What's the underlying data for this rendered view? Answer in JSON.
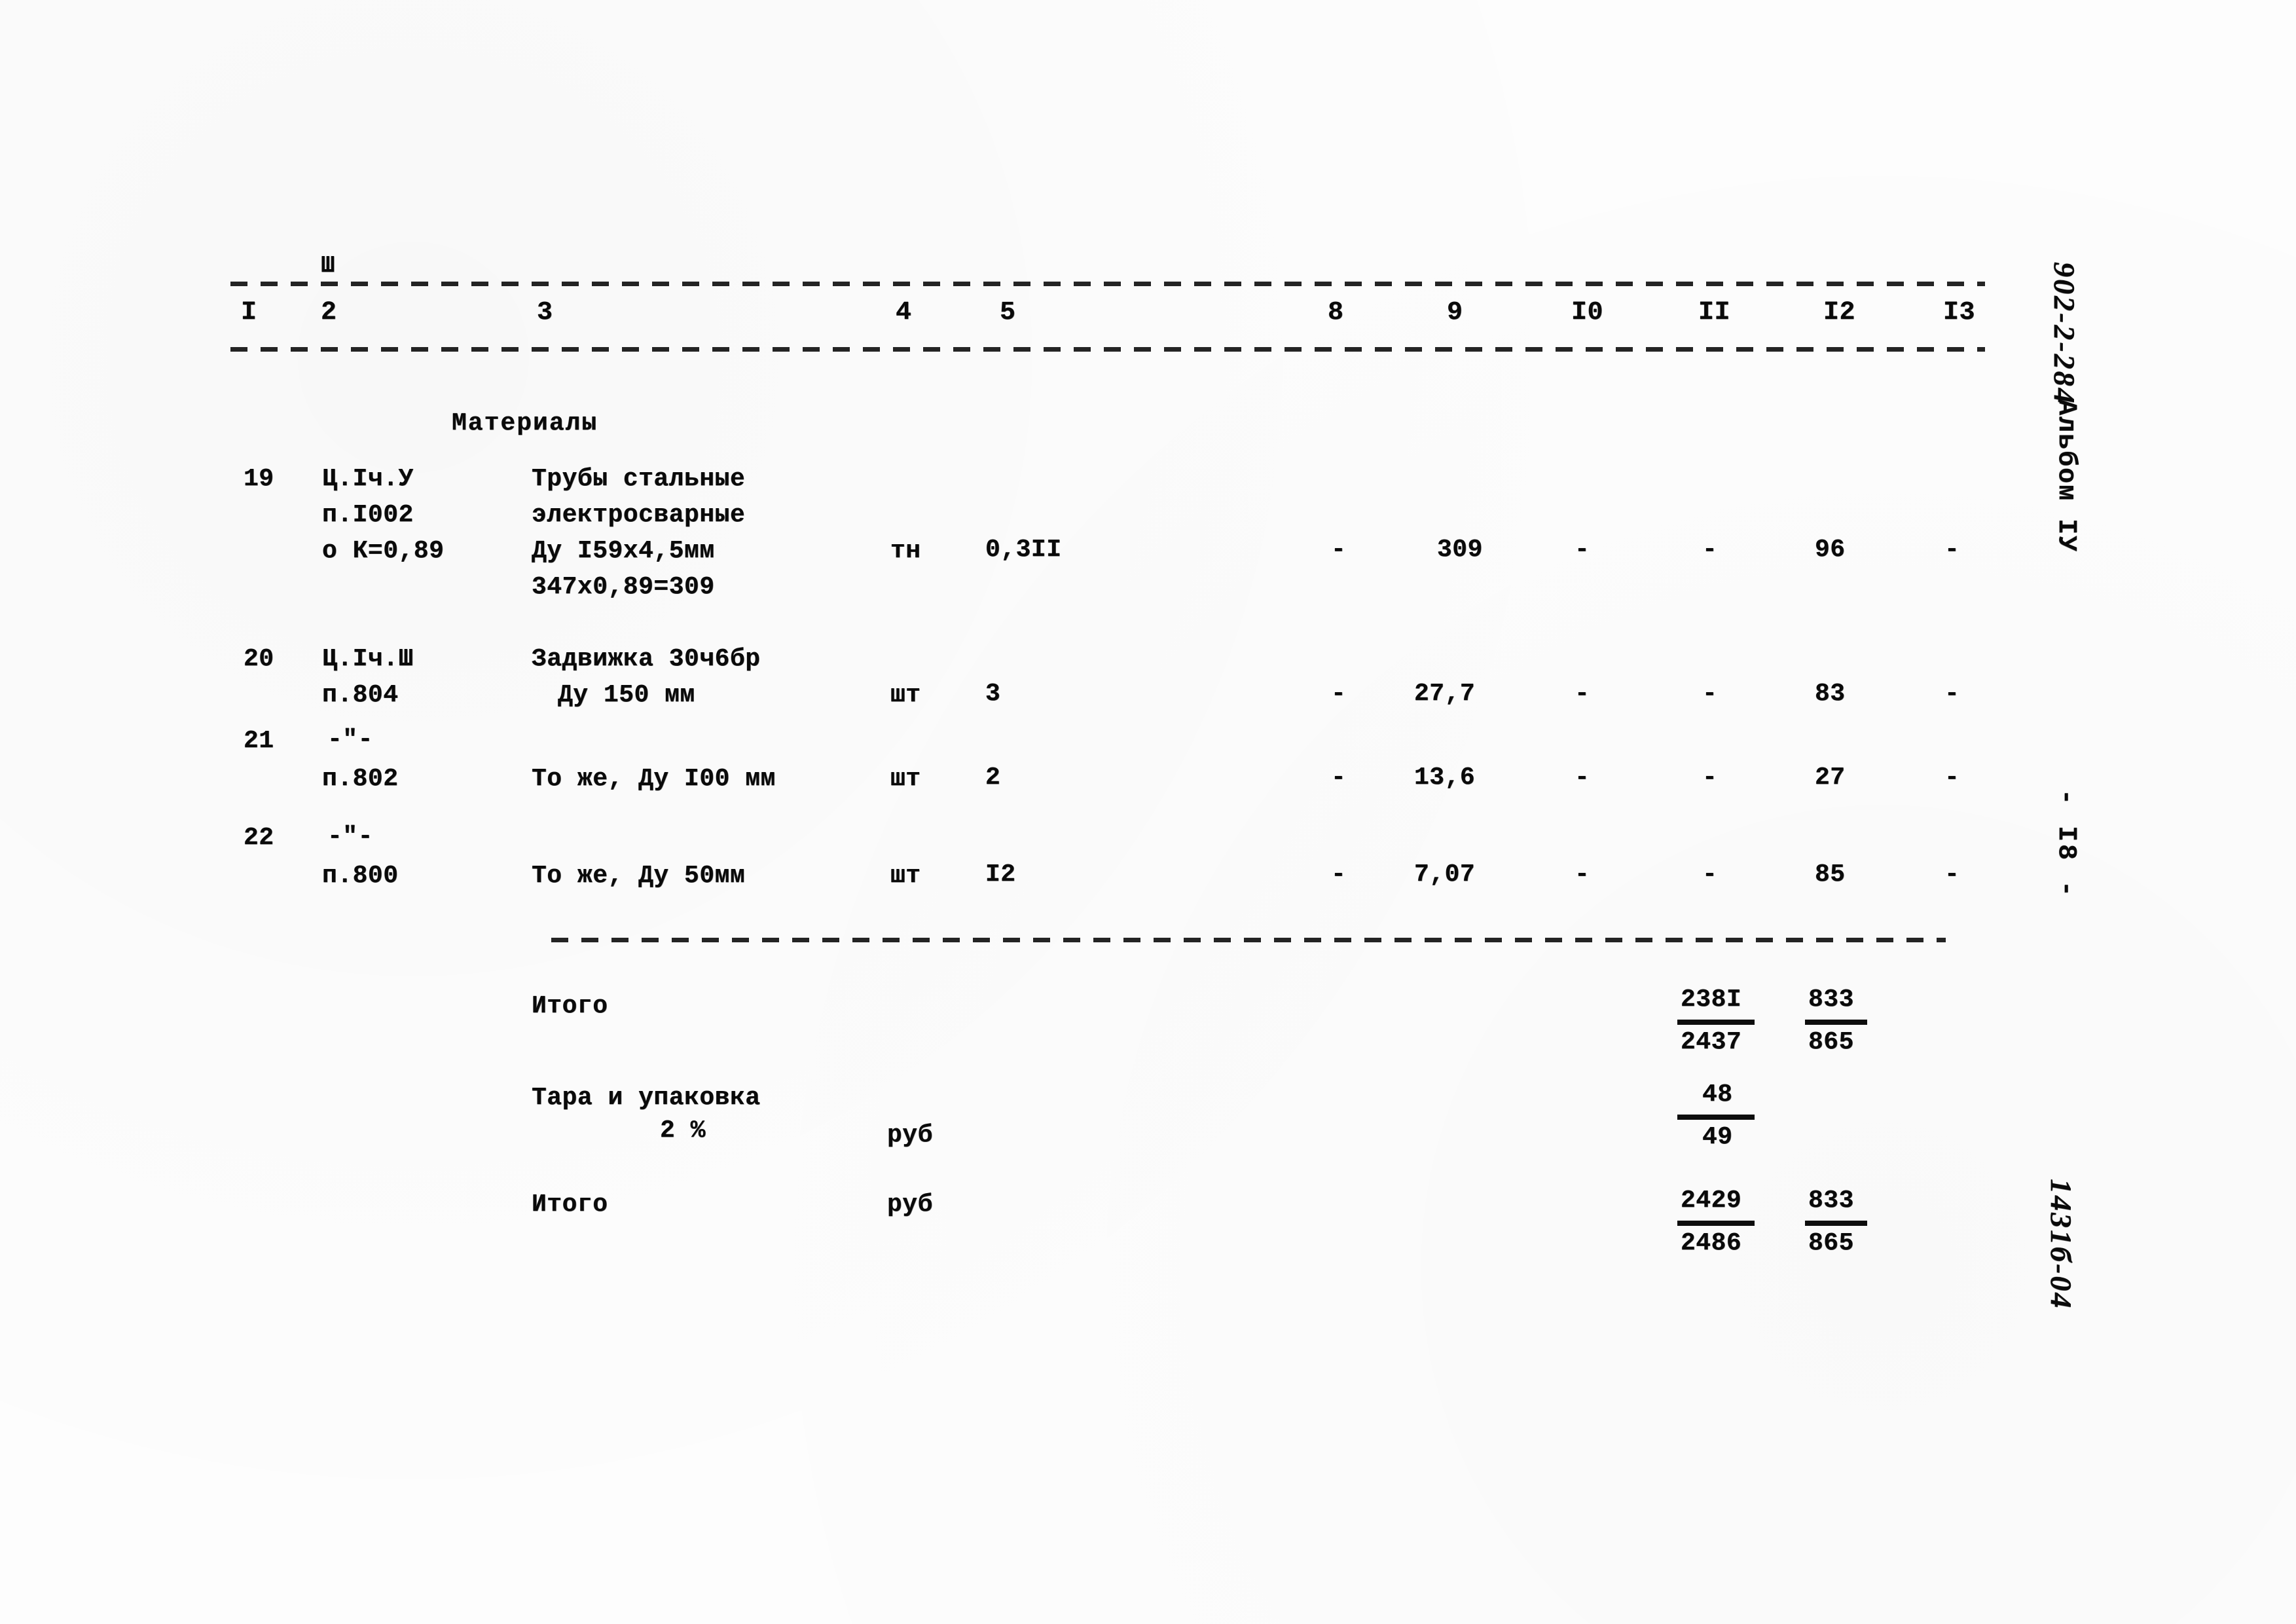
{
  "document": {
    "title_margin_code": "902-2-284",
    "album_label": "Альбом IУ",
    "page_label": "- I8 -",
    "archive_code": "1431б-04"
  },
  "table": {
    "column_headers": [
      "I",
      "2",
      "3",
      "4",
      "5",
      "8",
      "9",
      "I0",
      "II",
      "I2",
      "I3"
    ],
    "column2_superscript": "Ш",
    "section_title": "Материалы",
    "rows": [
      {
        "no": "19",
        "ref_lines": [
          "Ц.Iч.У",
          "п.I002",
          "о К=0,89"
        ],
        "name_lines": [
          "Трубы стальные",
          "электросварные",
          "Ду I59х4,5мм",
          "347х0,89=309"
        ],
        "unit": "тн",
        "qty": "0,3II",
        "c8": "-",
        "c9": "309",
        "c10": "-",
        "c11": "-",
        "c12": "96",
        "c13": "-"
      },
      {
        "no": "20",
        "ref_lines": [
          "Ц.Iч.Ш",
          "п.804"
        ],
        "name_lines": [
          "Задвижка 30ч6бр",
          "Ду 150 мм"
        ],
        "unit": "шт",
        "qty": "3",
        "c8": "-",
        "c9": "27,7",
        "c10": "-",
        "c11": "-",
        "c12": "83",
        "c13": "-"
      },
      {
        "no": "21",
        "ref_lines": [
          "-\"-",
          "п.802"
        ],
        "name_lines": [
          "То же, Ду I00 мм"
        ],
        "unit": "шт",
        "qty": "2",
        "c8": "-",
        "c9": "13,6",
        "c10": "-",
        "c11": "-",
        "c12": "27",
        "c13": "-"
      },
      {
        "no": "22",
        "ref_lines": [
          "-\"-",
          "п.800"
        ],
        "name_lines": [
          "То же, Ду 50мм"
        ],
        "unit": "шт",
        "qty": "I2",
        "c8": "-",
        "c9": "7,07",
        "c10": "-",
        "c11": "-",
        "c12": "85",
        "c13": "-"
      }
    ],
    "totals": [
      {
        "label": "Итого",
        "label2": "",
        "unit": "",
        "c11_top": "238I",
        "c11_bottom": "2437",
        "c12_top": "833",
        "c12_bottom": "865"
      },
      {
        "label": "Тара и упаковка",
        "label2": "2 %",
        "unit": "руб",
        "c11_top": "48",
        "c11_bottom": "49",
        "c12_top": "",
        "c12_bottom": ""
      },
      {
        "label": "Итого",
        "label2": "",
        "unit": "руб",
        "c11_top": "2429",
        "c11_bottom": "2486",
        "c12_top": "833",
        "c12_bottom": "865"
      }
    ]
  }
}
